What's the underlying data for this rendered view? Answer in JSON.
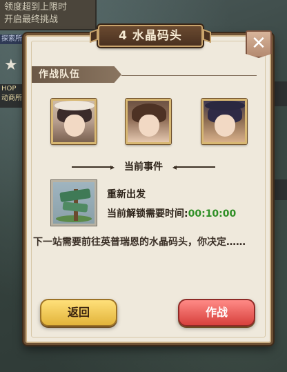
{
  "background": {
    "banner_lines": [
      "领度超到上限时",
      "开启最终挑战"
    ],
    "left_tag": "探索所",
    "shop_label": "HOP 动商所"
  },
  "dialog": {
    "title": "4 水晶码头",
    "close_symbol": "✕",
    "team_section": "作战队伍",
    "portraits": [
      {
        "icon": "character-portrait-1"
      },
      {
        "icon": "character-portrait-2"
      },
      {
        "icon": "character-portrait-3"
      }
    ],
    "event_header": "当前事件",
    "event_icon": "signpost-icon",
    "event_name": "重新出发",
    "unlock_label": "当前解锁需要时间:",
    "unlock_time": "00:10:00",
    "description": "下一站需要前往英普瑞恩的水晶码头，你决定……",
    "buttons": {
      "back": "返回",
      "fight": "作战"
    }
  },
  "colors": {
    "panel_bg": "#efe9dc",
    "time_green": "#2f8f26",
    "back_button": "#e2b43b",
    "fight_button": "#d7413d"
  }
}
